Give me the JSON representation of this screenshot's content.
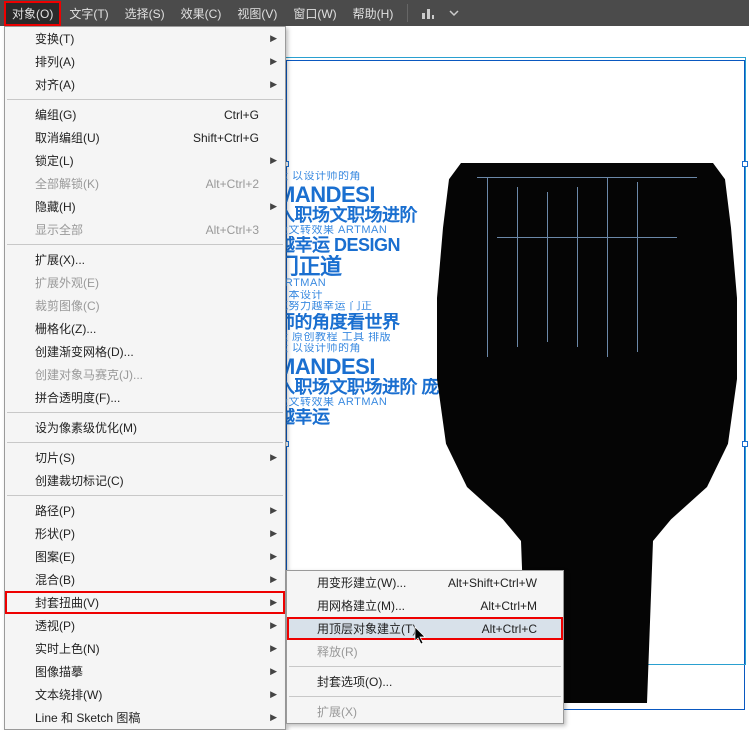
{
  "menubar": {
    "items": [
      {
        "label": "对象(O)",
        "active": true
      },
      {
        "label": "文字(T)"
      },
      {
        "label": "选择(S)"
      },
      {
        "label": "效果(C)"
      },
      {
        "label": "视图(V)"
      },
      {
        "label": "窗口(W)"
      },
      {
        "label": "帮助(H)"
      }
    ]
  },
  "dropdown": {
    "items": [
      {
        "label": "变换(T)",
        "arrow": true
      },
      {
        "label": "排列(A)",
        "arrow": true
      },
      {
        "label": "对齐(A)",
        "arrow": true
      },
      {
        "sep": true
      },
      {
        "label": "编组(G)",
        "shortcut": "Ctrl+G"
      },
      {
        "label": "取消编组(U)",
        "shortcut": "Shift+Ctrl+G"
      },
      {
        "label": "锁定(L)",
        "arrow": true
      },
      {
        "label": "全部解锁(K)",
        "shortcut": "Alt+Ctrl+2",
        "disabled": true
      },
      {
        "label": "隐藏(H)",
        "arrow": true
      },
      {
        "label": "显示全部",
        "shortcut": "Alt+Ctrl+3",
        "disabled": true
      },
      {
        "sep": true
      },
      {
        "label": "扩展(X)..."
      },
      {
        "label": "扩展外观(E)",
        "disabled": true
      },
      {
        "label": "裁剪图像(C)",
        "disabled": true
      },
      {
        "label": "栅格化(Z)..."
      },
      {
        "label": "创建渐变网格(D)..."
      },
      {
        "label": "创建对象马赛克(J)...",
        "disabled": true
      },
      {
        "label": "拼合透明度(F)..."
      },
      {
        "sep": true
      },
      {
        "label": "设为像素级优化(M)"
      },
      {
        "sep": true
      },
      {
        "label": "切片(S)",
        "arrow": true
      },
      {
        "label": "创建裁切标记(C)"
      },
      {
        "sep": true
      },
      {
        "label": "路径(P)",
        "arrow": true
      },
      {
        "label": "形状(P)",
        "arrow": true
      },
      {
        "label": "图案(E)",
        "arrow": true
      },
      {
        "label": "混合(B)",
        "arrow": true
      },
      {
        "label": "封套扭曲(V)",
        "arrow": true,
        "highlight": true
      },
      {
        "label": "透视(P)",
        "arrow": true
      },
      {
        "label": "实时上色(N)",
        "arrow": true
      },
      {
        "label": "图像描摹",
        "arrow": true
      },
      {
        "label": "文本绕排(W)",
        "arrow": true
      },
      {
        "label": "Line 和 Sketch 图稿",
        "arrow": true
      }
    ]
  },
  "submenu": {
    "items": [
      {
        "label": "用变形建立(W)...",
        "shortcut": "Alt+Shift+Ctrl+W"
      },
      {
        "label": "用网格建立(M)...",
        "shortcut": "Alt+Ctrl+M"
      },
      {
        "label": "用顶层对象建立(T)",
        "shortcut": "Alt+Ctrl+C",
        "highlight": true
      },
      {
        "label": "释放(R)",
        "disabled": true
      },
      {
        "sep": true
      },
      {
        "label": "封套选项(O)..."
      },
      {
        "sep": true
      },
      {
        "label": "扩展(X)",
        "disabled": true
      }
    ]
  },
  "bgtext": {
    "l1": "运 以设计师的角",
    "l2": "MANDESI",
    "l3": "入职场文职场进阶",
    "l4": "版文转效果 ARTMAN",
    "l5": "越幸运 DESIGN",
    "l6": "门正道",
    "l7": "ARTMAN",
    "l8": "日本设计",
    "l9": "庞努力越幸运 门正",
    "l10": "师的角度看世界",
    "l11": "运 原创教程 工具 排版",
    "l12": "运 以设计师的角",
    "l13": "MANDESI",
    "l14": "入职场文职场进阶 庞",
    "l15": "版文转效果 ARTMAN",
    "l16": "越幸运"
  }
}
